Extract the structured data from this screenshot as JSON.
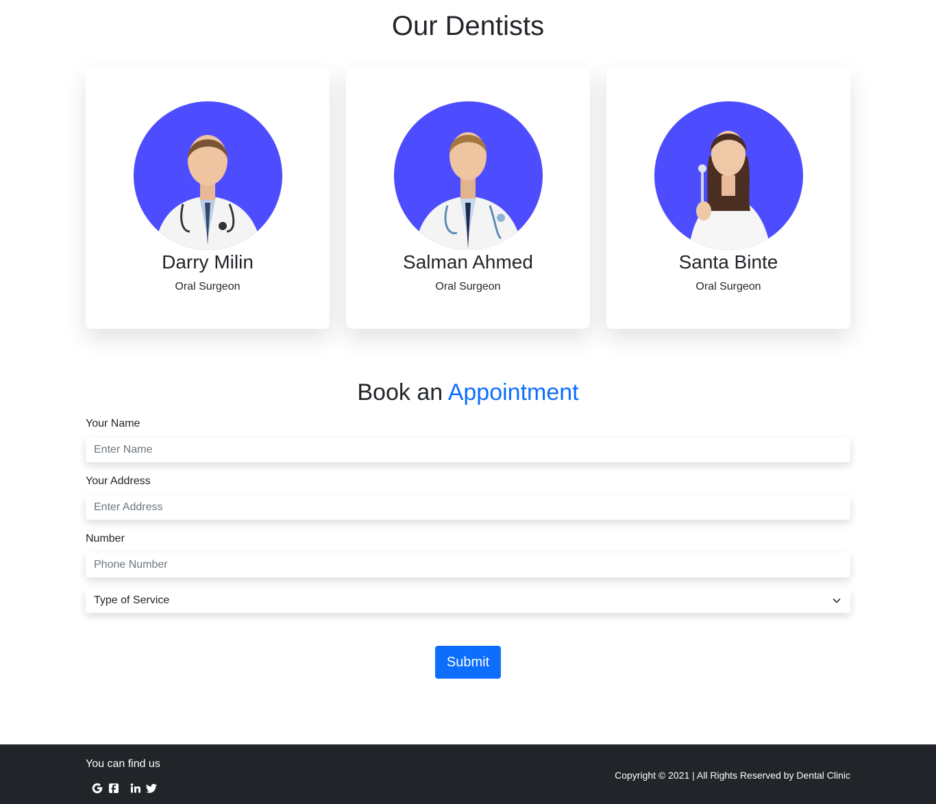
{
  "dentists_section": {
    "title": "Our Dentists",
    "dentists": [
      {
        "name": "Darry Milin",
        "role": "Oral Surgeon"
      },
      {
        "name": "Salman Ahmed",
        "role": "Oral Surgeon"
      },
      {
        "name": "Santa Binte",
        "role": "Oral Surgeon"
      }
    ]
  },
  "booking": {
    "title_prefix": "Book an",
    "title_accent": "Appointment",
    "name_label": "Your Name",
    "name_placeholder": "Enter Name",
    "address_label": "Your Address",
    "address_placeholder": "Enter Address",
    "number_label": "Number",
    "number_placeholder": "Phone Number",
    "service_select": "Type of Service",
    "submit_label": "Submit"
  },
  "footer": {
    "find_us": "You can find us",
    "social_icons": [
      "google-icon",
      "facebook-icon",
      "linkedin-icon",
      "twitter-icon"
    ],
    "copyright": "Copyright © 2021 | All Rights Reserved by Dental Clinic"
  },
  "colors": {
    "accent": "#0d6efd",
    "avatar_bg": "#4d4dff",
    "footer_bg": "#212529"
  }
}
